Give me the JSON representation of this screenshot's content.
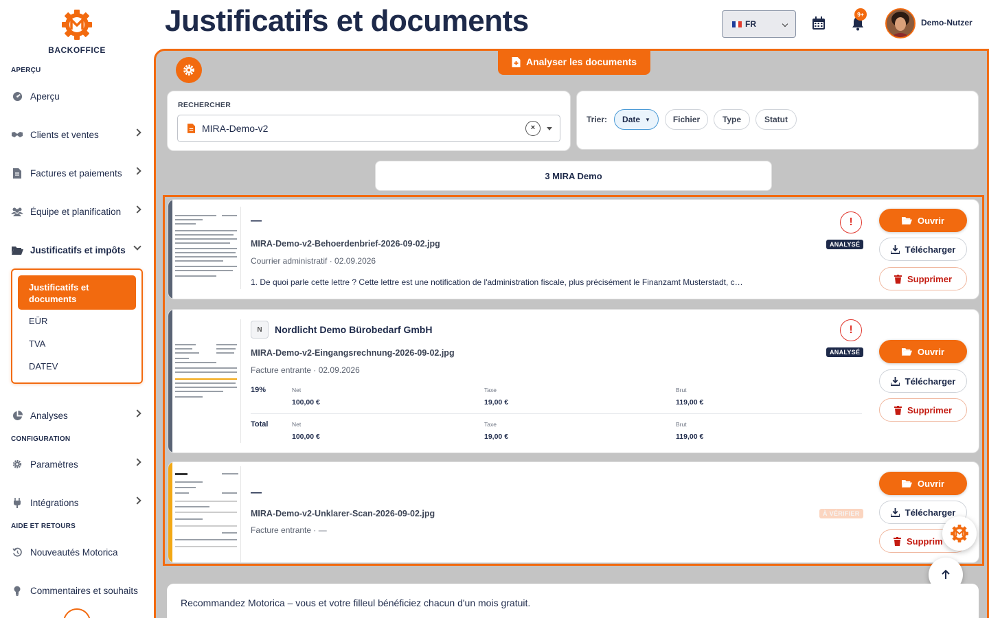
{
  "brand": {
    "name": "BACKOFFICE",
    "accent": "#f26a0f",
    "dark": "#1e2a4a"
  },
  "sidebar": {
    "sections": {
      "overview": "APERÇU",
      "config": "CONFIGURATION",
      "help": "AIDE ET RETOURS"
    },
    "items": [
      {
        "label": "Aperçu",
        "icon": "dashboard-icon"
      },
      {
        "label": "Clients et ventes",
        "icon": "handshake-icon"
      },
      {
        "label": "Factures et paiements",
        "icon": "invoice-icon"
      },
      {
        "label": "Équipe et planification",
        "icon": "users-icon"
      },
      {
        "label": "Justificatifs et impôts",
        "icon": "folder-open-icon"
      },
      {
        "label": "Analyses",
        "icon": "pie-chart-icon"
      },
      {
        "label": "Paramètres",
        "icon": "gear-icon"
      },
      {
        "label": "Intégrations",
        "icon": "plug-icon"
      },
      {
        "label": "Nouveautés Motorica",
        "icon": "history-icon"
      },
      {
        "label": "Commentaires et souhaits",
        "icon": "lightbulb-icon"
      }
    ],
    "submenu": [
      {
        "label": "Justificatifs et documents"
      },
      {
        "label": "EÜR"
      },
      {
        "label": "TVA"
      },
      {
        "label": "DATEV"
      }
    ]
  },
  "header": {
    "title": "Justificatifs et documents",
    "language": "FR",
    "notifications_badge": "9+",
    "user_name": "Demo-Nutzer"
  },
  "toolbar": {
    "analyze_label": "Analyser les documents"
  },
  "search": {
    "label": "RECHERCHER",
    "value": "MIRA-Demo-v2",
    "clear": "×"
  },
  "sort": {
    "label": "Trier:",
    "options": [
      "Date",
      "Fichier",
      "Type",
      "Statut"
    ],
    "active": "Date",
    "direction_glyph": "▼"
  },
  "group": {
    "label": "3 MIRA Demo"
  },
  "documents": [
    {
      "title": "—",
      "filename": "MIRA-Demo-v2-Behoerdenbrief-2026-09-02.jpg",
      "meta": "Courrier administratif · 02.09.2026",
      "summary": "1. De quoi parle cette lettre ? Cette lettre est une notification de l'administration fiscale, plus précisément le Finanzamt Musterstadt, c…",
      "status": "ANALYSÉ",
      "alert": "!"
    },
    {
      "vendor_initial": "N",
      "title": "Nordlicht Demo Bürobedarf GmbH",
      "filename": "MIRA-Demo-v2-Eingangsrechnung-2026-09-02.jpg",
      "meta": "Facture entrante · 02.09.2026",
      "status": "ANALYSÉ",
      "alert": "!",
      "tax_rows": [
        {
          "label": "19%",
          "net_label": "Net",
          "net": "100,00 €",
          "tax_label": "Taxe",
          "tax": "19,00 €",
          "gross_label": "Brut",
          "gross": "119,00 €"
        },
        {
          "label": "Total",
          "net_label": "Net",
          "net": "100,00 €",
          "tax_label": "Taxe",
          "tax": "19,00 €",
          "gross_label": "Brut",
          "gross": "119,00 €"
        }
      ]
    },
    {
      "title": "—",
      "filename": "MIRA-Demo-v2-Unklarer-Scan-2026-09-02.jpg",
      "meta": "Facture entrante · —",
      "status": "À VÉRIFIER"
    }
  ],
  "actions": {
    "open": "Ouvrir",
    "download": "Télécharger",
    "delete": "Supprimer",
    "delete_truncated": "Supprim"
  },
  "referral": {
    "text": "Recommandez Motorica – vous et votre filleul bénéficiez chacun d'un mois gratuit."
  }
}
